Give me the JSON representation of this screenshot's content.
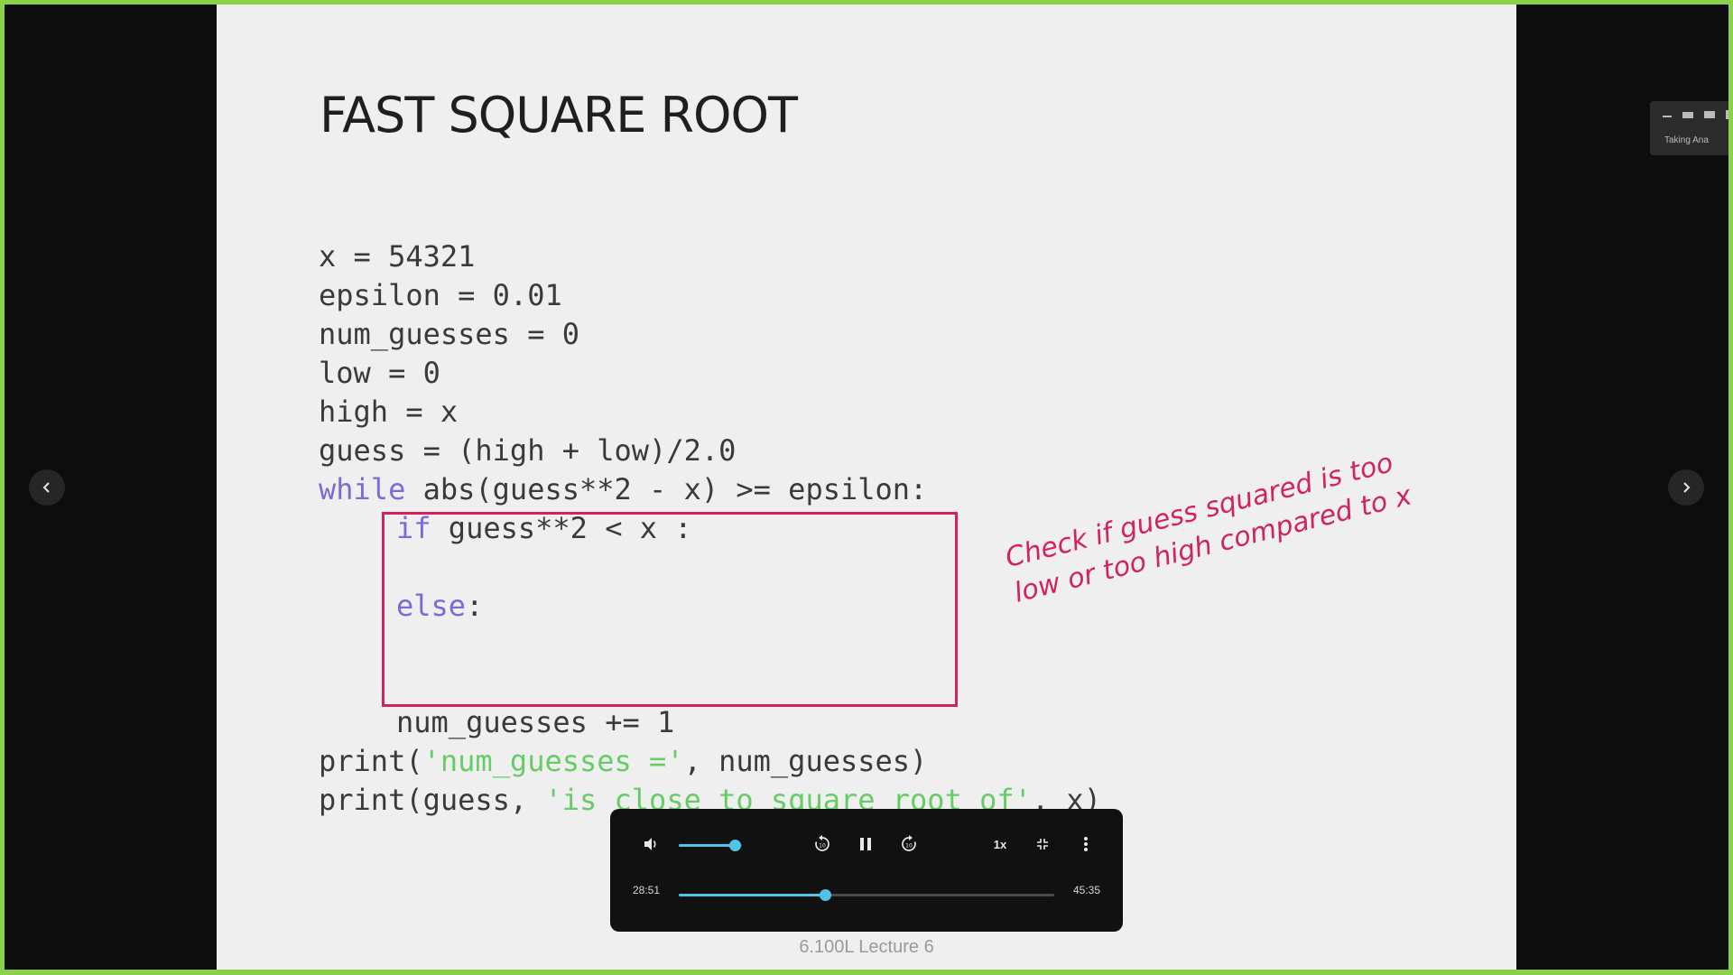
{
  "slide": {
    "title": "FAST SQUARE ROOT",
    "code": {
      "l1": "x = 54321",
      "l2": "epsilon = 0.01",
      "l3": "num_guesses = 0",
      "l4": "low = 0",
      "l5": "high = x",
      "l6": "guess = (high + low)/2.0",
      "l7_kw": "while",
      "l7_rest": " abs(guess**2 - x) >= epsilon:",
      "l8_kw": "if",
      "l8_rest": " guess**2 < x :",
      "l10_kw": "else",
      "l10_rest": ":",
      "l13": "num_guesses += 1",
      "l14_a": "print(",
      "l14_str": "'num_guesses ='",
      "l14_b": ", num_guesses)",
      "l15_a": "print(guess, ",
      "l15_str": "'is close to square root of'",
      "l15_b": ", x)"
    },
    "annotation": "Check if guess squared is too low or too high compared to x",
    "footer": "6.100L Lecture 6"
  },
  "nav": {
    "prev_icon": "chevron-left-icon",
    "next_icon": "chevron-right-icon"
  },
  "mini_widget": {
    "text": "Taking Ana"
  },
  "player": {
    "current_time": "28:51",
    "total_time": "45:35",
    "playback_rate": "1x",
    "volume_level": 0.88,
    "progress": 0.39,
    "icons": [
      "volume-icon",
      "rewind-10-icon",
      "pause-icon",
      "forward-10-icon",
      "exit-fullscreen-icon",
      "more-options-icon"
    ]
  },
  "colors": {
    "keyword": "#7b6ad8",
    "string": "#66cc66",
    "highlight": "#d0245a",
    "frame": "#8ccf4a",
    "player_accent": "#4fc3e8"
  }
}
